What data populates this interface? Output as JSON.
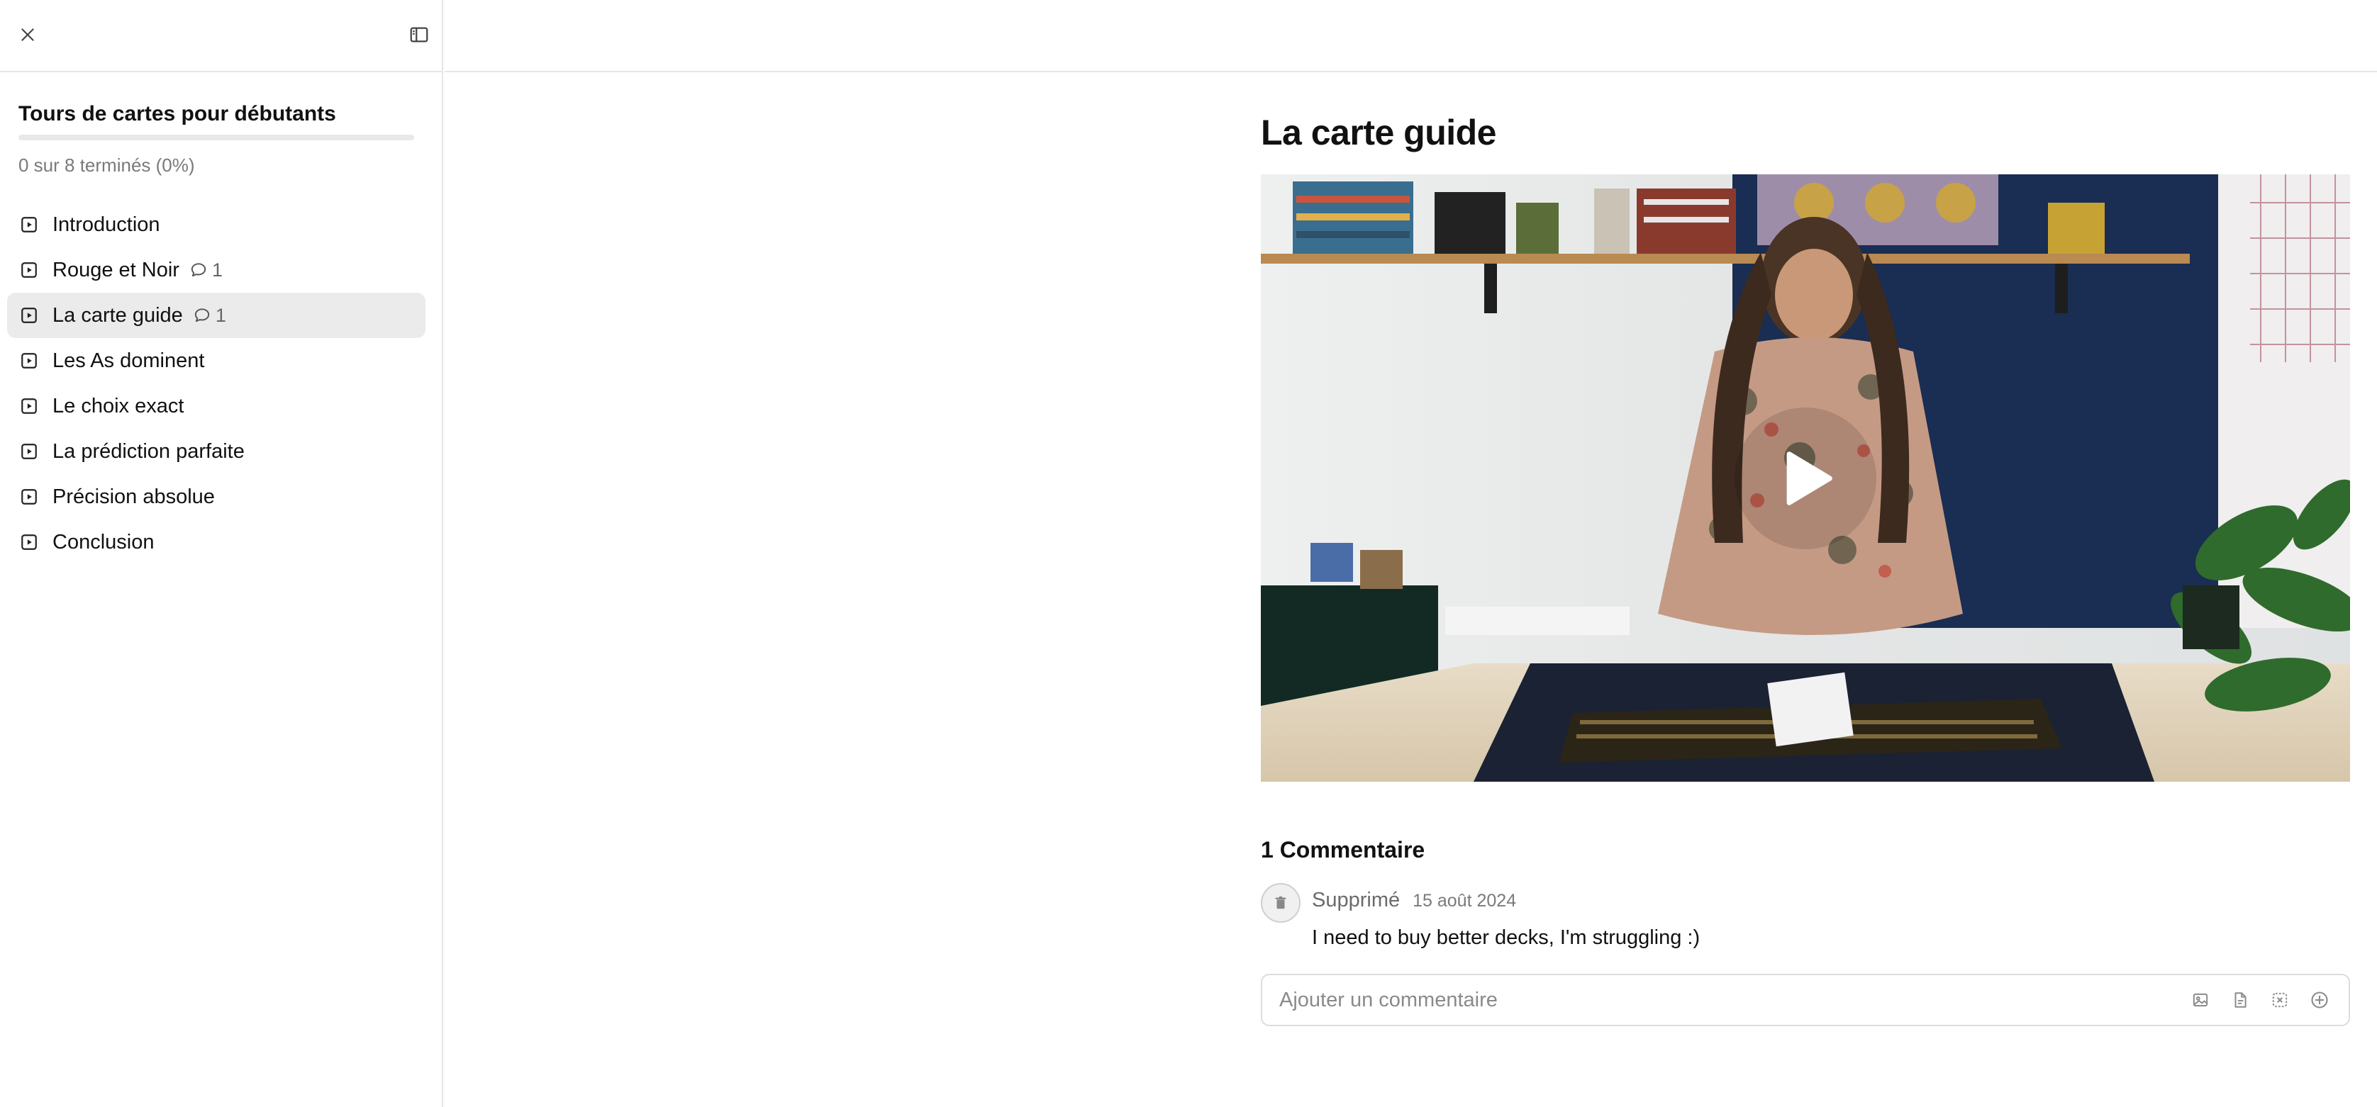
{
  "sidebar": {
    "close_icon": "close-icon",
    "toggle_icon": "sidebar-toggle-icon",
    "course_title": "Tours de cartes pour débutants",
    "progress_fraction": 0,
    "progress_text": "0 sur 8 terminés (0%)",
    "lessons": [
      {
        "label": "Introduction",
        "comments": ""
      },
      {
        "label": "Rouge et Noir",
        "comments": "1"
      },
      {
        "label": "La carte guide",
        "comments": "1",
        "active": true
      },
      {
        "label": "Les As dominent",
        "comments": ""
      },
      {
        "label": "Le choix exact",
        "comments": ""
      },
      {
        "label": "La prédiction parfaite",
        "comments": ""
      },
      {
        "label": "Précision absolue",
        "comments": ""
      },
      {
        "label": "Conclusion",
        "comments": ""
      }
    ]
  },
  "main": {
    "title": "La carte guide",
    "video": {
      "play_icon": "play-icon"
    },
    "comments_heading": "1 Commentaire",
    "comments": [
      {
        "author": "Supprimé",
        "date": "15 août 2024",
        "text": "I need to buy better decks, I'm struggling :)"
      }
    ],
    "comment_placeholder": "Ajouter un commentaire",
    "composer_icons": [
      "image-icon",
      "file-icon",
      "gif-icon",
      "add-circle-icon"
    ]
  }
}
